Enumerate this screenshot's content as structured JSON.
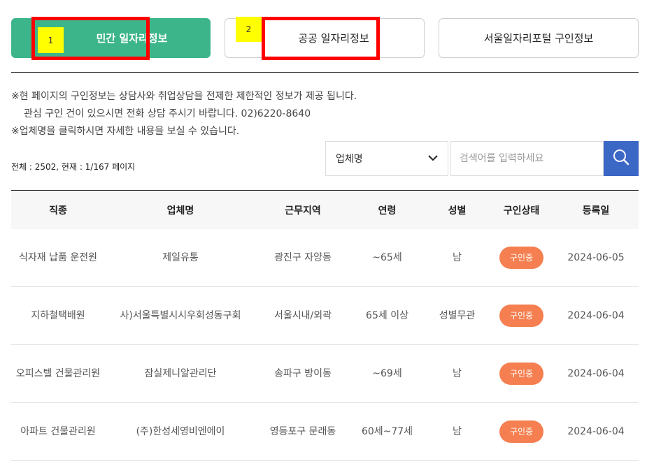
{
  "tabs": [
    {
      "label": "민간 일자리정보",
      "marker": "1"
    },
    {
      "label": "공공 일자리정보",
      "marker": "2"
    },
    {
      "label": "서울일자리포털 구인정보"
    }
  ],
  "notice": [
    "※현 페이지의 구인정보는 상담사와 취업상담을 전제한 제한적인 정보가 제공 됩니다.",
    "관심 구인 건이 있으시면 전화 상담 주시기 바랍니다. 02)6220-8640",
    "※업체명을 클릭하시면 자세한 내용을 보실 수 있습니다."
  ],
  "total_text": "전체 : 2502, 현재 : 1/167 페이지",
  "search": {
    "select_value": "업체명",
    "placeholder": "검색어를 입력하세요"
  },
  "table": {
    "headers": [
      "직종",
      "업체명",
      "근무지역",
      "연령",
      "성별",
      "구인상태",
      "등록일"
    ],
    "rows": [
      [
        "식자재 납품 운전원",
        "제일유통",
        "광진구 자양동",
        "~65세",
        "남",
        "구인중",
        "2024-06-05"
      ],
      [
        "지하철택배원",
        "사)서울특별시시우회성동구회",
        "서울시내/외곽",
        "65세 이상",
        "성별무관",
        "구인중",
        "2024-06-04"
      ],
      [
        "오피스텔 건물관리원",
        "잠실제니알관리단",
        "송파구 방이동",
        "~69세",
        "남",
        "구인중",
        "2024-06-04"
      ],
      [
        "아파트 건물관리원",
        "(주)한성세영비엔에이",
        "영등포구 문래동",
        "60세~77세",
        "남",
        "구인중",
        "2024-06-04"
      ]
    ]
  },
  "colors": {
    "active_tab": "#3db58a",
    "search_button": "#3b67c5",
    "badge": "#f57f50",
    "highlight": "#ff0000"
  },
  "icons": {
    "select": "chevron-down-icon",
    "search_button": "search-icon"
  }
}
